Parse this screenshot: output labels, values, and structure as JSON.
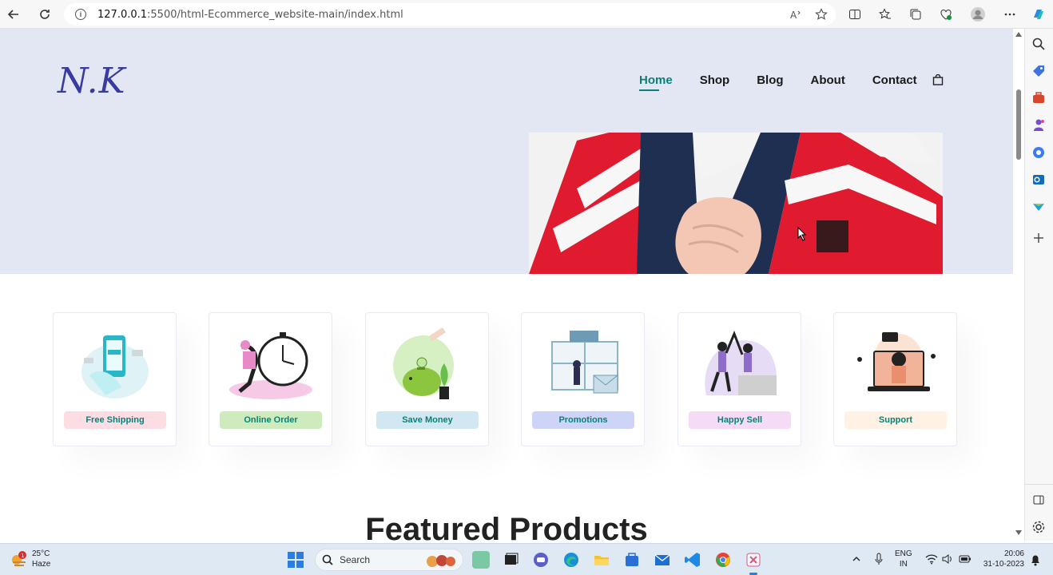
{
  "browser": {
    "url_host": "127.0.0.1",
    "url_path": ":5500/html-Ecommerce_website-main/index.html"
  },
  "site": {
    "logo_text": "N.K",
    "menu": [
      {
        "label": "Home",
        "active": true
      },
      {
        "label": "Shop",
        "active": false
      },
      {
        "label": "Blog",
        "active": false
      },
      {
        "label": "About",
        "active": false
      },
      {
        "label": "Contact",
        "active": false
      }
    ],
    "features": [
      {
        "label": "Free Shipping",
        "bg": "#fddde4"
      },
      {
        "label": "Online Order",
        "bg": "#cdebbc"
      },
      {
        "label": "Save Money",
        "bg": "#d1e8f2"
      },
      {
        "label": "Promotions",
        "bg": "#cdd4f8"
      },
      {
        "label": "Happy Sell",
        "bg": "#f6dbf6"
      },
      {
        "label": "Support",
        "bg": "#fff2e5"
      }
    ],
    "featured_heading": "Featured Products"
  },
  "taskbar": {
    "weather_temp": "25°C",
    "weather_desc": "Haze",
    "weather_badge": "1",
    "search_label": "Search",
    "lang_top": "ENG",
    "lang_bottom": "IN",
    "time": "20:06",
    "date": "31-10-2023"
  },
  "colors": {
    "accent": "#088178",
    "header_bg": "#e3e6f3"
  }
}
